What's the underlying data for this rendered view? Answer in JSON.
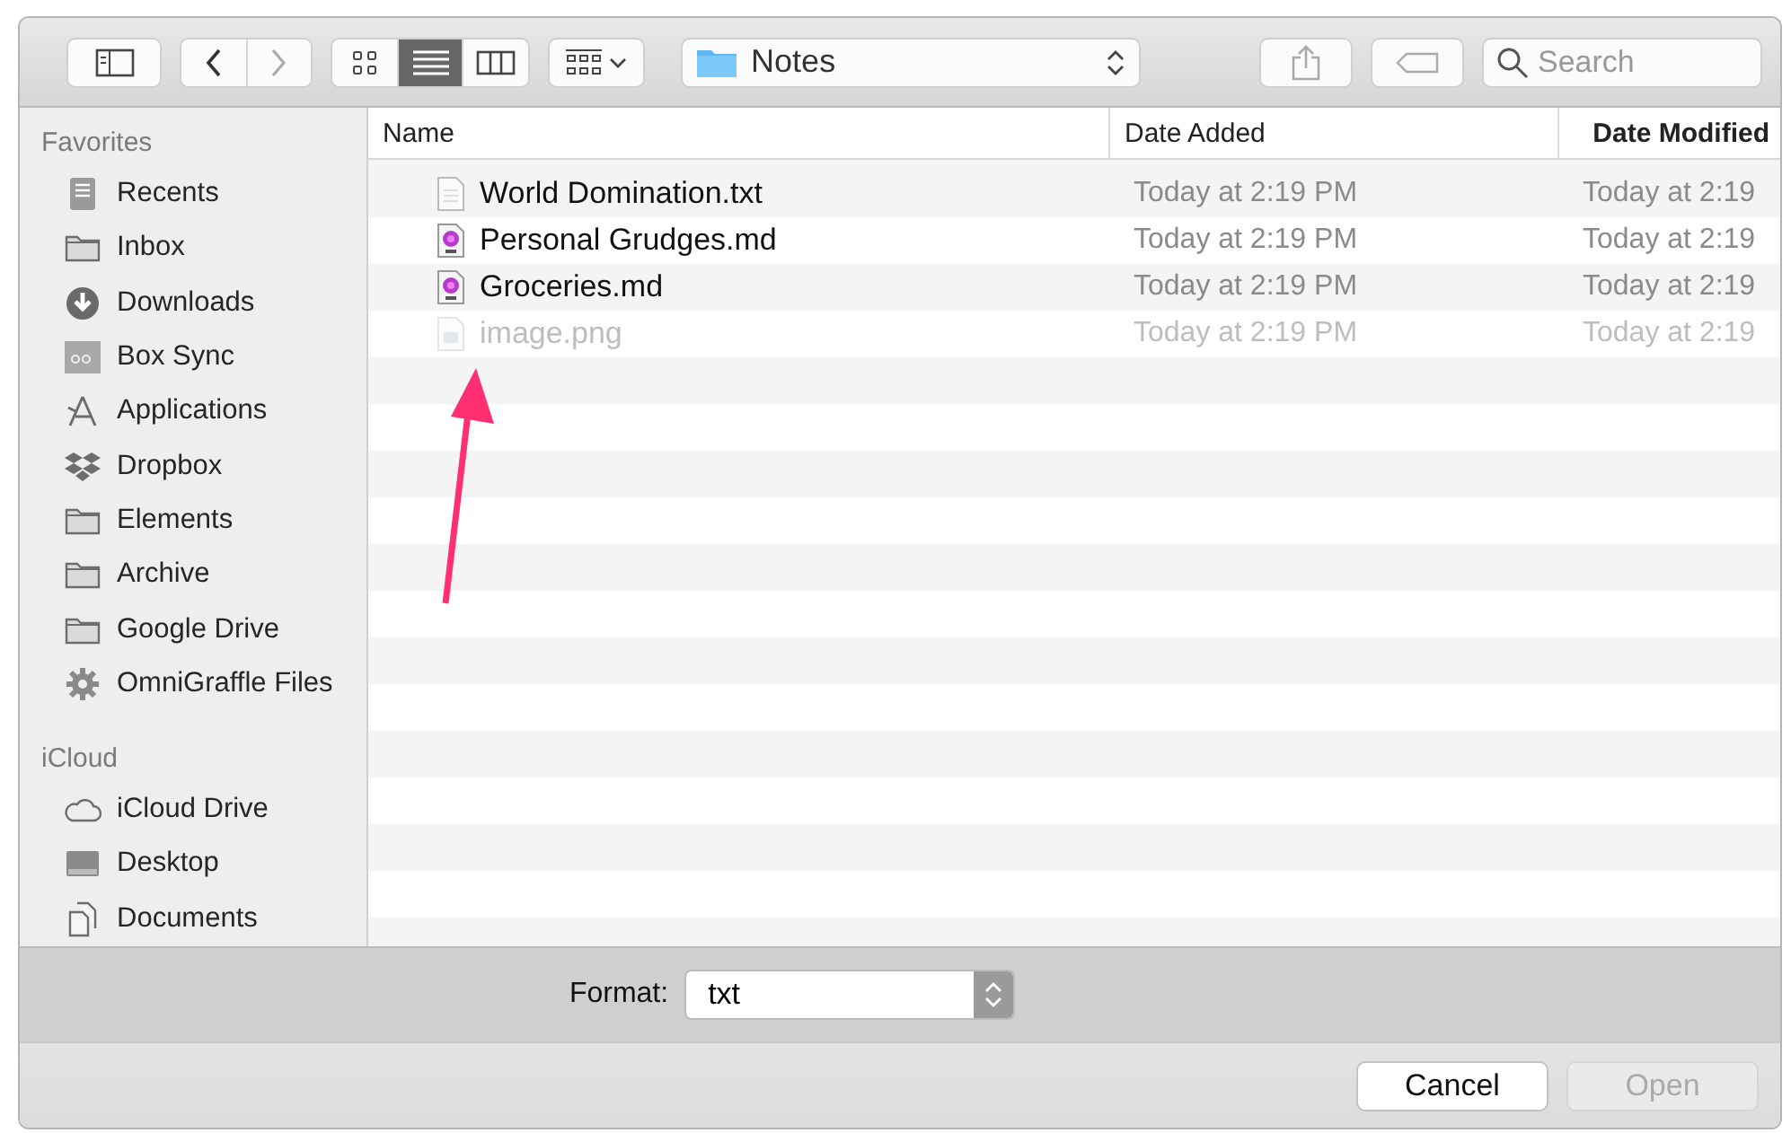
{
  "toolbar": {
    "view_modes": [
      {
        "kind": "icons",
        "selected": false
      },
      {
        "kind": "list",
        "selected": true
      },
      {
        "kind": "columns",
        "selected": false
      }
    ],
    "location": "Notes",
    "search": {
      "placeholder": "Search"
    }
  },
  "sidebar": {
    "sections": [
      {
        "title": "Favorites",
        "items": [
          {
            "label": "Recents",
            "kind": "recents"
          },
          {
            "label": "Inbox",
            "kind": "folder"
          },
          {
            "label": "Downloads",
            "kind": "downloads"
          },
          {
            "label": "Box Sync",
            "kind": "box"
          },
          {
            "label": "Applications",
            "kind": "applications"
          },
          {
            "label": "Dropbox",
            "kind": "dropbox"
          },
          {
            "label": "Elements",
            "kind": "folder"
          },
          {
            "label": "Archive",
            "kind": "folder"
          },
          {
            "label": "Google Drive",
            "kind": "folder"
          },
          {
            "label": "OmniGraffle Files",
            "kind": "gear"
          }
        ]
      },
      {
        "title": "iCloud",
        "items": [
          {
            "label": "iCloud Drive",
            "kind": "cloud"
          },
          {
            "label": "Desktop",
            "kind": "desktop"
          },
          {
            "label": "Documents",
            "kind": "documents"
          }
        ]
      }
    ]
  },
  "table": {
    "columns": [
      "Name",
      "Date Added",
      "Date Modified"
    ],
    "rows": [
      {
        "name": "World Domination.txt",
        "kind": "text",
        "date_added": "Today at 2:19 PM",
        "date_modified": "Today at 2:19",
        "disabled": false
      },
      {
        "name": "Personal Grudges.md",
        "kind": "markdown",
        "date_added": "Today at 2:19 PM",
        "date_modified": "Today at 2:19",
        "disabled": false
      },
      {
        "name": "Groceries.md",
        "kind": "markdown",
        "date_added": "Today at 2:19 PM",
        "date_modified": "Today at 2:19",
        "disabled": false
      },
      {
        "name": "image.png",
        "kind": "image",
        "date_added": "Today at 2:19 PM",
        "date_modified": "Today at 2:19",
        "disabled": true
      }
    ]
  },
  "format": {
    "label": "Format:",
    "value": "txt"
  },
  "buttons": [
    {
      "label": "Cancel",
      "disabled": false
    },
    {
      "label": "Open",
      "disabled": true
    }
  ],
  "annotations": [
    {
      "kind": "arrow"
    }
  ]
}
